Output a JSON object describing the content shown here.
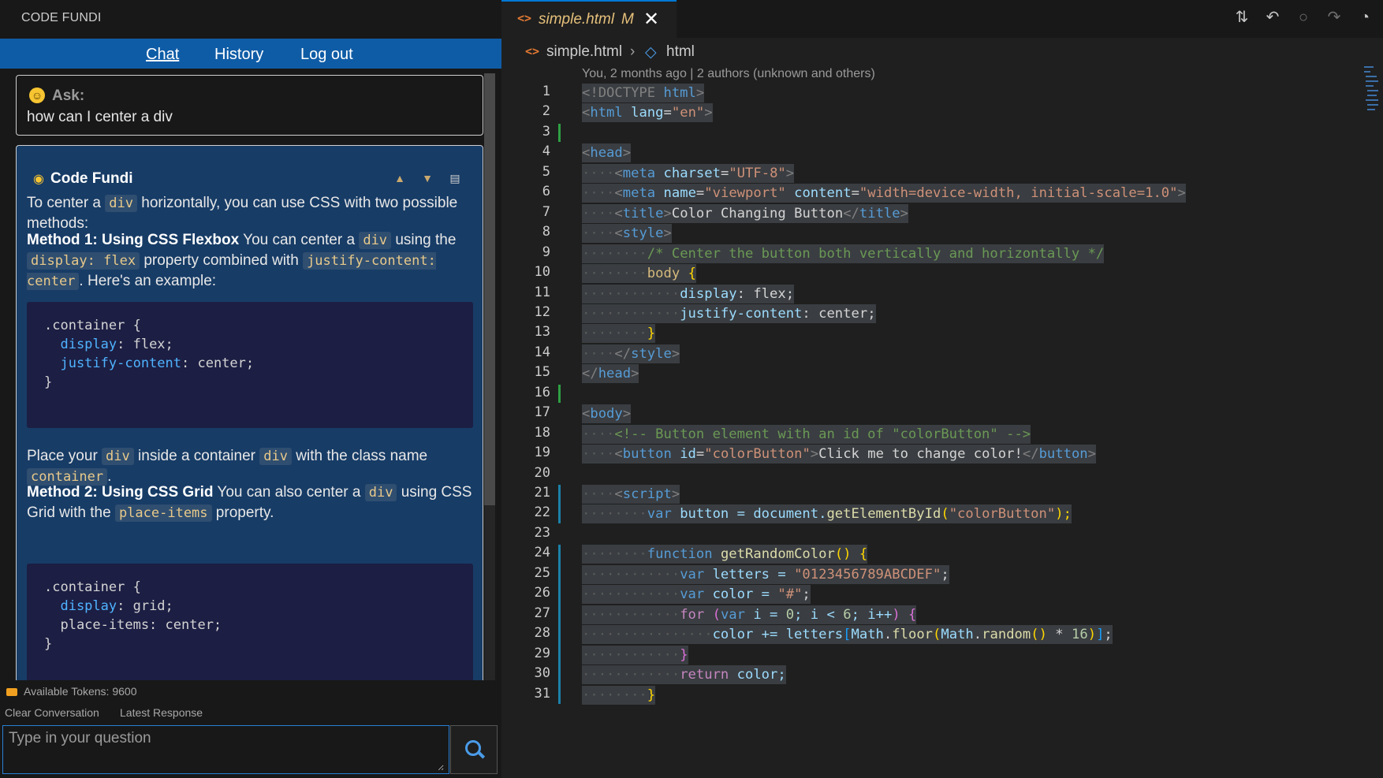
{
  "left_panel": {
    "title": "CODE FUNDI",
    "nav": {
      "chat": "Chat",
      "history": "History",
      "logout": "Log out"
    },
    "ask": {
      "label": "Ask:",
      "text": "how can I center a div"
    },
    "response": {
      "name": "Code Fundi",
      "actions": [
        "thumbs-up-icon",
        "thumbs-down-icon",
        "clipboard-icon"
      ],
      "p1": {
        "a": "To center a ",
        "b": "div",
        "c": " horizontally, you can use CSS with two possible methods:"
      },
      "p2": {
        "bold": "Method 1: Using CSS Flexbox",
        "a": " You can center a ",
        "b": "div",
        "c": " using the ",
        "d": "display: flex",
        "e": " property combined with ",
        "f": "justify-content: center",
        "g": ". Here's an example:"
      },
      "code1": [
        ".container {",
        "  display: flex;",
        "  justify-content: center;",
        "}"
      ],
      "p3": {
        "a": "Place your ",
        "b": "div",
        "c": " inside a container ",
        "d": "div",
        "e": " with the class name ",
        "f": "container",
        "g": "."
      },
      "p4": {
        "bold": "Method 2: Using CSS Grid",
        "a": " You can also center a ",
        "b": "div",
        "c": " using CSS Grid with the ",
        "d": "place-items",
        "e": " property."
      },
      "code2": [
        ".container {",
        "  display: grid;",
        "  place-items: center;",
        "}"
      ]
    },
    "tokens": "Available Tokens: 9600",
    "clear": "Clear Conversation",
    "latest": "Latest Response",
    "input_placeholder": "Type in your question"
  },
  "editor": {
    "tab": {
      "name": "simple.html",
      "status": "M"
    },
    "toolbar_icons": [
      "compare-changes-icon",
      "go-back-icon",
      "circle-icon",
      "go-forward-icon",
      "timeline-icon"
    ],
    "breadcrumb": {
      "file": "simple.html",
      "symbol": "html"
    },
    "blame": "You, 2 months ago | 2 authors (unknown and others)",
    "line_numbers": [
      "1",
      "2",
      "3",
      "4",
      "5",
      "6",
      "7",
      "8",
      "9",
      "10",
      "11",
      "12",
      "13",
      "14",
      "15",
      "16",
      "17",
      "18",
      "19",
      "20",
      "21",
      "22",
      "23",
      "24",
      "25",
      "26",
      "27",
      "28",
      "29",
      "30",
      "31"
    ],
    "tokens": {
      "l1": [
        "<!DOCTYPE",
        " html",
        ">"
      ],
      "l2": [
        "<",
        "html",
        " lang",
        "=",
        "\"en\"",
        ">"
      ],
      "l4": [
        "<",
        "head",
        ">"
      ],
      "l5": [
        "····",
        "<",
        "meta",
        " charset",
        "=",
        "\"UTF-8\"",
        ">"
      ],
      "l6": [
        "····",
        "<",
        "meta",
        " name",
        "=",
        "\"viewport\"",
        " content",
        "=",
        "\"width=device-width, initial-scale=1.0\"",
        ">"
      ],
      "l7": [
        "····",
        "<",
        "title",
        ">",
        "Color Changing Button",
        "</",
        "title",
        ">"
      ],
      "l8": [
        "····",
        "<",
        "style",
        ">"
      ],
      "l9": [
        "········",
        "/* Center the button both vertically and horizontally */"
      ],
      "l10": [
        "········",
        "body",
        " ",
        "{"
      ],
      "l11": [
        "············",
        "display",
        ": flex;"
      ],
      "l12": [
        "············",
        "justify-content",
        ": center;"
      ],
      "l13": [
        "········",
        "}"
      ],
      "l14": [
        "····",
        "</",
        "style",
        ">"
      ],
      "l15": [
        "</",
        "head",
        ">"
      ],
      "l17": [
        "<",
        "body",
        ">"
      ],
      "l18": [
        "····",
        "<!-- Button element with an id of \"colorButton\" -->"
      ],
      "l19": [
        "····",
        "<",
        "button",
        " id",
        "=",
        "\"colorButton\"",
        ">",
        "Click me to change color!",
        "</",
        "button",
        ">"
      ],
      "l21": [
        "····",
        "<",
        "script",
        ">"
      ],
      "l22": [
        "········",
        "var",
        " button = document.",
        "getElementById",
        "(",
        "\"colorButton\"",
        ");"
      ],
      "l24": [
        "········",
        "function",
        " ",
        "getRandomColor",
        "() ",
        "{"
      ],
      "l25": [
        "············",
        "var",
        " letters = ",
        "\"0123456789ABCDEF\"",
        ";"
      ],
      "l26": [
        "············",
        "var",
        " color = ",
        "\"#\"",
        ";"
      ],
      "l27": [
        "············",
        "for",
        " ",
        "(",
        "var",
        " i = ",
        "0",
        "; i < ",
        "6",
        "; i++",
        ")",
        " ",
        "{"
      ],
      "l28": [
        "················",
        "color += letters",
        "[",
        "Math",
        ".",
        "floor",
        "(",
        "Math",
        ".",
        "random",
        "()",
        " * ",
        "16",
        ")",
        "]",
        ";"
      ],
      "l29": [
        "············",
        "}"
      ],
      "l30": [
        "············",
        "return",
        " color;"
      ],
      "l31": [
        "········",
        "}"
      ]
    }
  }
}
